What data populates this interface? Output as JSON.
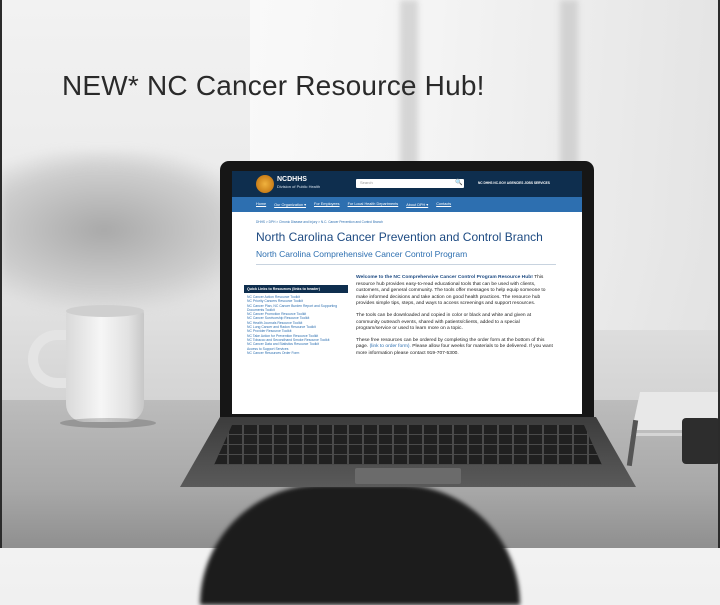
{
  "slide": {
    "title": "NEW* NC Cancer Resource Hub!"
  },
  "website": {
    "logo": {
      "title": "NCDHHS",
      "subtitle": "Division of Public Health"
    },
    "search": {
      "placeholder": "Search"
    },
    "top_links": "NC DHHS  NC.GOV  AGENCIES  JOBS  SERVICES",
    "nav": [
      "Home",
      "Our Organization ▾",
      "For Employees",
      "For Local Health Departments",
      "About DPH ▾",
      "Contacts"
    ],
    "breadcrumb": "DHHS  >  DPH  >  Chronic Disease and Injury  >  N.C. Cancer Prevention and Control Branch",
    "heading": "North Carolina Cancer Prevention and Control Branch",
    "subheading": "North Carolina Comprehensive Cancer Control Program",
    "quick_links": {
      "header": "Quick Links to Resources (links to header)",
      "items": [
        "NC Cancer Action Resource Toolkit",
        "NC Priority Cancers Resource Toolkit",
        "NC Cancer Plan, NC Cancer Burden Report and Supporting Documents Toolkit",
        "NC Cancer Promotion Resource Toolkit",
        "NC Cancer Survivorship Resource Toolkit",
        "NC Health Journals Resource Toolkit",
        "NC Lung Cancer and Radon Resource Toolkit",
        "NC Provider Resource Toolkit",
        "NC Take Action for Prevention Resource Toolkit",
        "NC Tobacco and Secondhand Smoke Resource Toolkit",
        "NC Cancer Data and Statistics Resource Toolkit",
        "Access to Support Services",
        "NC Cancer Resources Order Form"
      ]
    },
    "content": {
      "lead": "Welcome to the NC Comprehensive Cancer Control Program Resource Hub!",
      "p1": "This resource hub provides easy-to-read educational tools that can be used with clients, customers, and general community. The tools offer messages to help equip someone to make informed decisions and take action on good health practices. The resource hub provides simple tips, steps, and ways to access screenings and support resources.",
      "p2": "The tools can be downloaded and copied in color or black and white and given at community outreach events, shared with patients/clients, added to a special program/service or used to learn more on a topic.",
      "p3a": "These free resources can be ordered by completing the order form at the bottom of this page.",
      "p3_link": "(link to order form).",
      "p3b": "Please allow four weeks for materials to be delivered. If you want more information please contact 919-707-5300."
    }
  }
}
